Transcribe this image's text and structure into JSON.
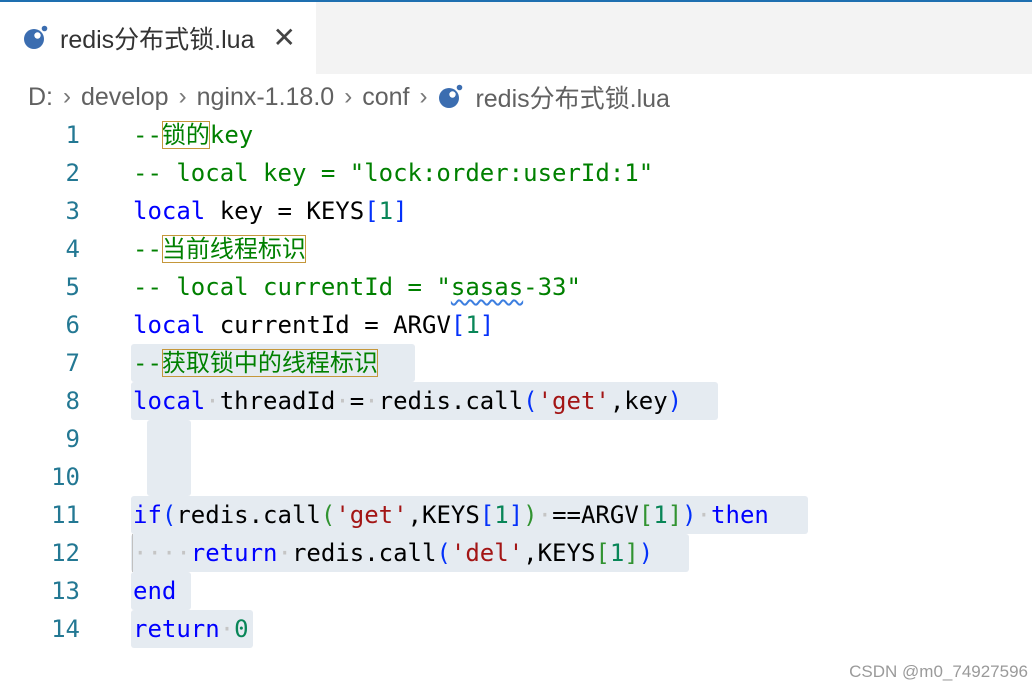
{
  "tab": {
    "title": "redis分布式锁.lua",
    "close": "✕"
  },
  "breadcrumb": {
    "drive": "D:",
    "folder1": "develop",
    "folder2": "nginx-1.18.0",
    "folder3": "conf",
    "file": "redis分布式锁.lua",
    "separator": "›"
  },
  "editor": {
    "line_numbers": [
      "1",
      "2",
      "3",
      "4",
      "5",
      "6",
      "7",
      "8",
      "9",
      "10",
      "11",
      "12",
      "13",
      "14"
    ],
    "lines": [
      "--锁的key",
      "-- local key = \"lock:order:userId:1\"",
      "local key = KEYS[1]",
      "--当前线程标识",
      "-- local currentId = \"sasas-33\"",
      "local currentId = ARGV[1]",
      "--获取锁中的线程标识",
      "local threadId = redis.call('get',key)",
      "",
      "",
      "if(redis.call('get',KEYS[1]) ==ARGV[1]) then",
      "    return redis.call('del',KEYS[1])",
      "end",
      "return 0"
    ]
  },
  "tokens": {
    "l1a": "--",
    "l1b": "锁的",
    "l1c": "key",
    "l2": "-- local key = \"lock:order:userId:1\"",
    "l3a": "local",
    "l3b": " key = KEYS",
    "l3c": "[",
    "l3d": "1",
    "l3e": "]",
    "l4a": "--",
    "l4b": "当前线程标识",
    "l5a": "-- local currentId = \"",
    "l5b": "sasas",
    "l5c": "-33\"",
    "l6a": "local",
    "l6b": " currentId = ARGV",
    "l6c": "[",
    "l6d": "1",
    "l6e": "]",
    "l7a": "--",
    "l7b": "获取锁中的线程标识",
    "l8a": "local",
    "l8b": "·",
    "l8c": "threadId",
    "l8d": "·",
    "l8e": "=",
    "l8f": "·",
    "l8g": "redis.call",
    "l8h": "(",
    "l8i": "'get'",
    "l8j": ",key",
    "l8k": ")",
    "l11a": "if",
    "l11b": "(",
    "l11c": "redis.call",
    "l11d": "(",
    "l11e": "'get'",
    "l11f": ",KEYS",
    "l11g": "[",
    "l11h": "1",
    "l11i": "]",
    "l11j": ")",
    "l11k": "·",
    "l11l": "==ARGV",
    "l11m": "[",
    "l11n": "1",
    "l11o": "]",
    "l11p": ")",
    "l11q": "·",
    "l11r": "then",
    "l12a": "····",
    "l12b": "return",
    "l12c": "·",
    "l12d": "redis.call",
    "l12e": "(",
    "l12f": "'del'",
    "l12g": ",KEYS",
    "l12h": "[",
    "l12i": "1",
    "l12j": "]",
    "l12k": ")",
    "l13": "end",
    "l14a": "return",
    "l14b": "·",
    "l14c": "0"
  },
  "watermark": "CSDN @m0_74927596",
  "colors": {
    "accent": "#1e6fb0",
    "comment": "#008000",
    "keyword": "#0000ff",
    "string": "#a31515",
    "number": "#098658",
    "line_number": "#237893"
  },
  "icons": {
    "file_icon": "lua-icon",
    "close_icon": "close-icon",
    "separator_icon": "chevron-right-icon"
  }
}
